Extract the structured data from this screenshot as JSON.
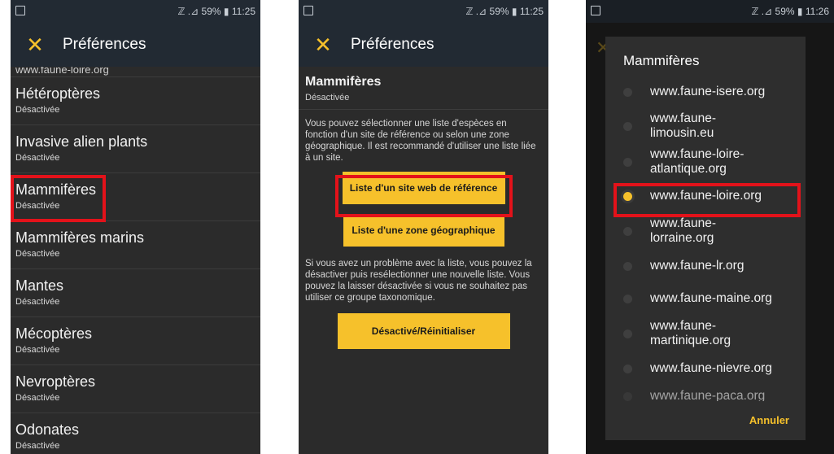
{
  "status": {
    "signal": "ℤ .⊿",
    "battery": "59%",
    "battery_icon": "▮",
    "time1": "11:25",
    "time2": "11:25",
    "time3": "11:26"
  },
  "toolbar": {
    "close_icon": "✕",
    "title": "Préférences"
  },
  "list": {
    "cut_text": "www.faune-loire.org",
    "items": [
      {
        "name": "Hétéroptères",
        "sub": "Désactivée"
      },
      {
        "name": "Invasive alien plants",
        "sub": "Désactivée"
      },
      {
        "name": "Mammifères",
        "sub": "Désactivée"
      },
      {
        "name": "Mammifères marins",
        "sub": "Désactivée"
      },
      {
        "name": "Mantes",
        "sub": "Désactivée"
      },
      {
        "name": "Mécoptères",
        "sub": "Désactivée"
      },
      {
        "name": "Nevroptères",
        "sub": "Désactivée"
      },
      {
        "name": "Odonates",
        "sub": "Désactivée"
      }
    ]
  },
  "detail": {
    "name": "Mammifères",
    "sub": "Désactivée",
    "para1": "Vous pouvez sélectionner une liste d'espèces en fonction d'un site de référence ou selon une zone géographique. Il est recommandé d'utiliser une liste liée à un site.",
    "btn_site": "Liste d'un site web de référence",
    "btn_zone": "Liste d'une zone géographique",
    "para2": "Si vous avez un problème avec la liste, vous pouvez la désactiver puis resélectionner une nouvelle liste. Vous pouvez la laisser désactivée si vous ne souhaitez pas utiliser ce groupe taxonomique.",
    "btn_reset": "Désactivé/Réinitialiser"
  },
  "dialog": {
    "title": "Mammifères",
    "options": [
      {
        "label": "www.faune-isere.org",
        "selected": false
      },
      {
        "label": "www.faune-limousin.eu",
        "selected": false
      },
      {
        "label": "www.faune-loire-atlantique.org",
        "selected": false
      },
      {
        "label": "www.faune-loire.org",
        "selected": true
      },
      {
        "label": "www.faune-lorraine.org",
        "selected": false
      },
      {
        "label": "www.faune-lr.org",
        "selected": false
      },
      {
        "label": "www.faune-maine.org",
        "selected": false
      },
      {
        "label": "www.faune-martinique.org",
        "selected": false
      },
      {
        "label": "www.faune-nievre.org",
        "selected": false
      },
      {
        "label": "www.faune-paca.org",
        "selected": false
      }
    ],
    "cancel": "Annuler"
  },
  "colors": {
    "accent": "#f6c12b",
    "highlight": "#e3121a",
    "toolbar": "#222a33",
    "background": "#2b2b2b"
  }
}
